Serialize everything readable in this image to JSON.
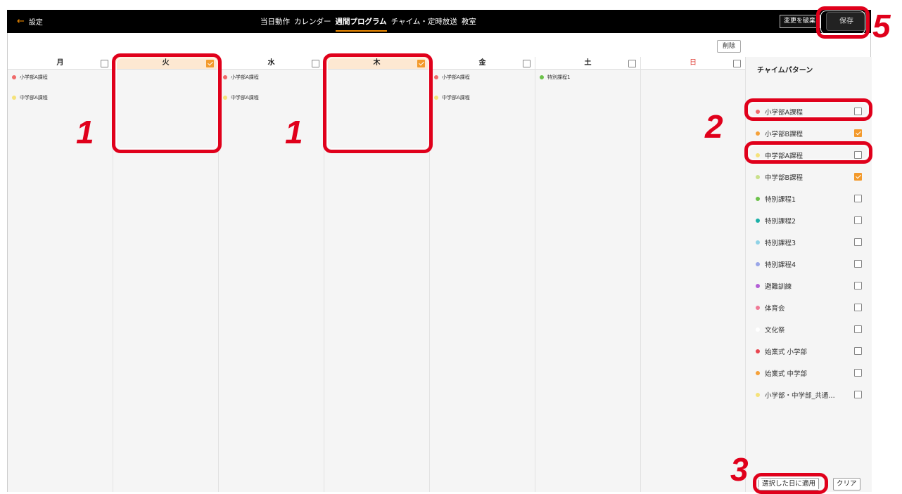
{
  "header": {
    "back_label": "設定",
    "tabs": [
      "当日動作",
      "カレンダー",
      "週間プログラム",
      "チャイム・定時放送",
      "教室"
    ],
    "active_tab": "週間プログラム",
    "discard_label": "変更を破棄",
    "save_label": "保存"
  },
  "toolbar": {
    "delete_label": "削除"
  },
  "days": [
    {
      "label": "月",
      "checked": false,
      "selected": false,
      "entries": [
        {
          "label": "小学部A課程",
          "color": "#f06a6a"
        },
        {
          "label": "中学部A課程",
          "color": "#f5e27a"
        }
      ]
    },
    {
      "label": "火",
      "checked": true,
      "selected": true,
      "entries": []
    },
    {
      "label": "水",
      "checked": false,
      "selected": false,
      "entries": [
        {
          "label": "小学部A課程",
          "color": "#f06a6a"
        },
        {
          "label": "中学部A課程",
          "color": "#f5e27a"
        }
      ]
    },
    {
      "label": "木",
      "checked": true,
      "selected": true,
      "entries": []
    },
    {
      "label": "金",
      "checked": false,
      "selected": false,
      "entries": [
        {
          "label": "小学部A課程",
          "color": "#f06a6a"
        },
        {
          "label": "中学部A課程",
          "color": "#f5e27a"
        }
      ]
    },
    {
      "label": "土",
      "checked": false,
      "selected": false,
      "entries": [
        {
          "label": "特別課程1",
          "color": "#6cc24a"
        }
      ]
    },
    {
      "label": "日",
      "checked": false,
      "selected": false,
      "sunday": true,
      "entries": []
    }
  ],
  "sidebar": {
    "title": "チャイムパターン",
    "patterns": [
      {
        "label": "小学部A課程",
        "color": "#f06a6a",
        "checked": false
      },
      {
        "label": "小学部B課程",
        "color": "#f5a13a",
        "checked": true
      },
      {
        "label": "中学部A課程",
        "color": "#f5e27a",
        "checked": false
      },
      {
        "label": "中学部B課程",
        "color": "#c9e08a",
        "checked": true
      },
      {
        "label": "特別課程1",
        "color": "#6cc24a",
        "checked": false
      },
      {
        "label": "特別課程2",
        "color": "#1bb0a8",
        "checked": false
      },
      {
        "label": "特別課程3",
        "color": "#8fd2e6",
        "checked": false
      },
      {
        "label": "特別課程4",
        "color": "#9aa6e8",
        "checked": false
      },
      {
        "label": "避難訓練",
        "color": "#b35fd6",
        "checked": false
      },
      {
        "label": "体育会",
        "color": "#f07a96",
        "checked": false
      },
      {
        "label": "文化祭",
        "color": "#ffffff",
        "checked": false
      },
      {
        "label": "始業式 小学部",
        "color": "#e8454f",
        "checked": false
      },
      {
        "label": "始業式 中学部",
        "color": "#f5a13a",
        "checked": false
      },
      {
        "label": "小学部・中学部_共通…",
        "color": "#f5e27a",
        "checked": false
      }
    ],
    "apply_label": "選択した日に適用",
    "clear_label": "クリア"
  },
  "annotations": {
    "step1": "1",
    "step1b": "1",
    "step2": "2",
    "step3": "3",
    "step5": "5",
    "color": "#e0001b"
  }
}
